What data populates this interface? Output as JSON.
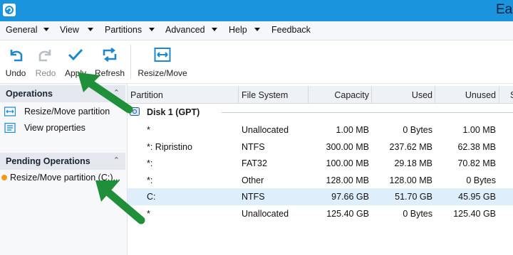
{
  "window": {
    "title": "Eas"
  },
  "menu": {
    "items": [
      {
        "label": "General",
        "has_arrow": true
      },
      {
        "label": "View",
        "has_arrow": true
      },
      {
        "label": "Partitions",
        "has_arrow": true
      },
      {
        "label": "Advanced",
        "has_arrow": true
      },
      {
        "label": "Help",
        "has_arrow": true
      },
      {
        "label": "Feedback",
        "has_arrow": false
      }
    ]
  },
  "toolbar": {
    "undo": "Undo",
    "redo": "Redo",
    "apply": "Apply",
    "refresh": "Refresh",
    "resize_move": "Resize/Move"
  },
  "operations": {
    "title": "Operations",
    "items": [
      {
        "label": "Resize/Move partition",
        "icon": "resize-move-icon"
      },
      {
        "label": "View properties",
        "icon": "properties-icon"
      }
    ]
  },
  "pending": {
    "title": "Pending Operations",
    "items": [
      {
        "label": "Resize/Move partition (C:)..."
      }
    ]
  },
  "table": {
    "columns": [
      "Partition",
      "File System",
      "Capacity",
      "Used",
      "Unused",
      "S"
    ],
    "disk": "Disk 1 (GPT)",
    "rows": [
      {
        "partition": "*",
        "fs": "Unallocated",
        "capacity": "1.00 MB",
        "used": "0 Bytes",
        "unused": "1.00 MB",
        "selected": false
      },
      {
        "partition": "*: Ripristino",
        "fs": "NTFS",
        "capacity": "300.00 MB",
        "used": "237.62 MB",
        "unused": "62.38 MB",
        "selected": false
      },
      {
        "partition": "*:",
        "fs": "FAT32",
        "capacity": "100.00 MB",
        "used": "29.18 MB",
        "unused": "70.82 MB",
        "selected": false
      },
      {
        "partition": "*:",
        "fs": "Other",
        "capacity": "128.00 MB",
        "used": "128.00 MB",
        "unused": "0 Bytes",
        "selected": false
      },
      {
        "partition": "C:",
        "fs": "NTFS",
        "capacity": "97.66 GB",
        "used": "51.70 GB",
        "unused": "45.95 GB",
        "selected": true
      },
      {
        "partition": "*",
        "fs": "Unallocated",
        "capacity": "125.40 GB",
        "used": "0 Bytes",
        "unused": "125.40 GB",
        "selected": false
      }
    ]
  },
  "colors": {
    "titlebar": "#1a95dd",
    "icon_blue": "#1e88c8",
    "arrow_green": "#1f8f3a",
    "pending_dot": "#f29a1f",
    "selected_row": "#dfeefb"
  }
}
